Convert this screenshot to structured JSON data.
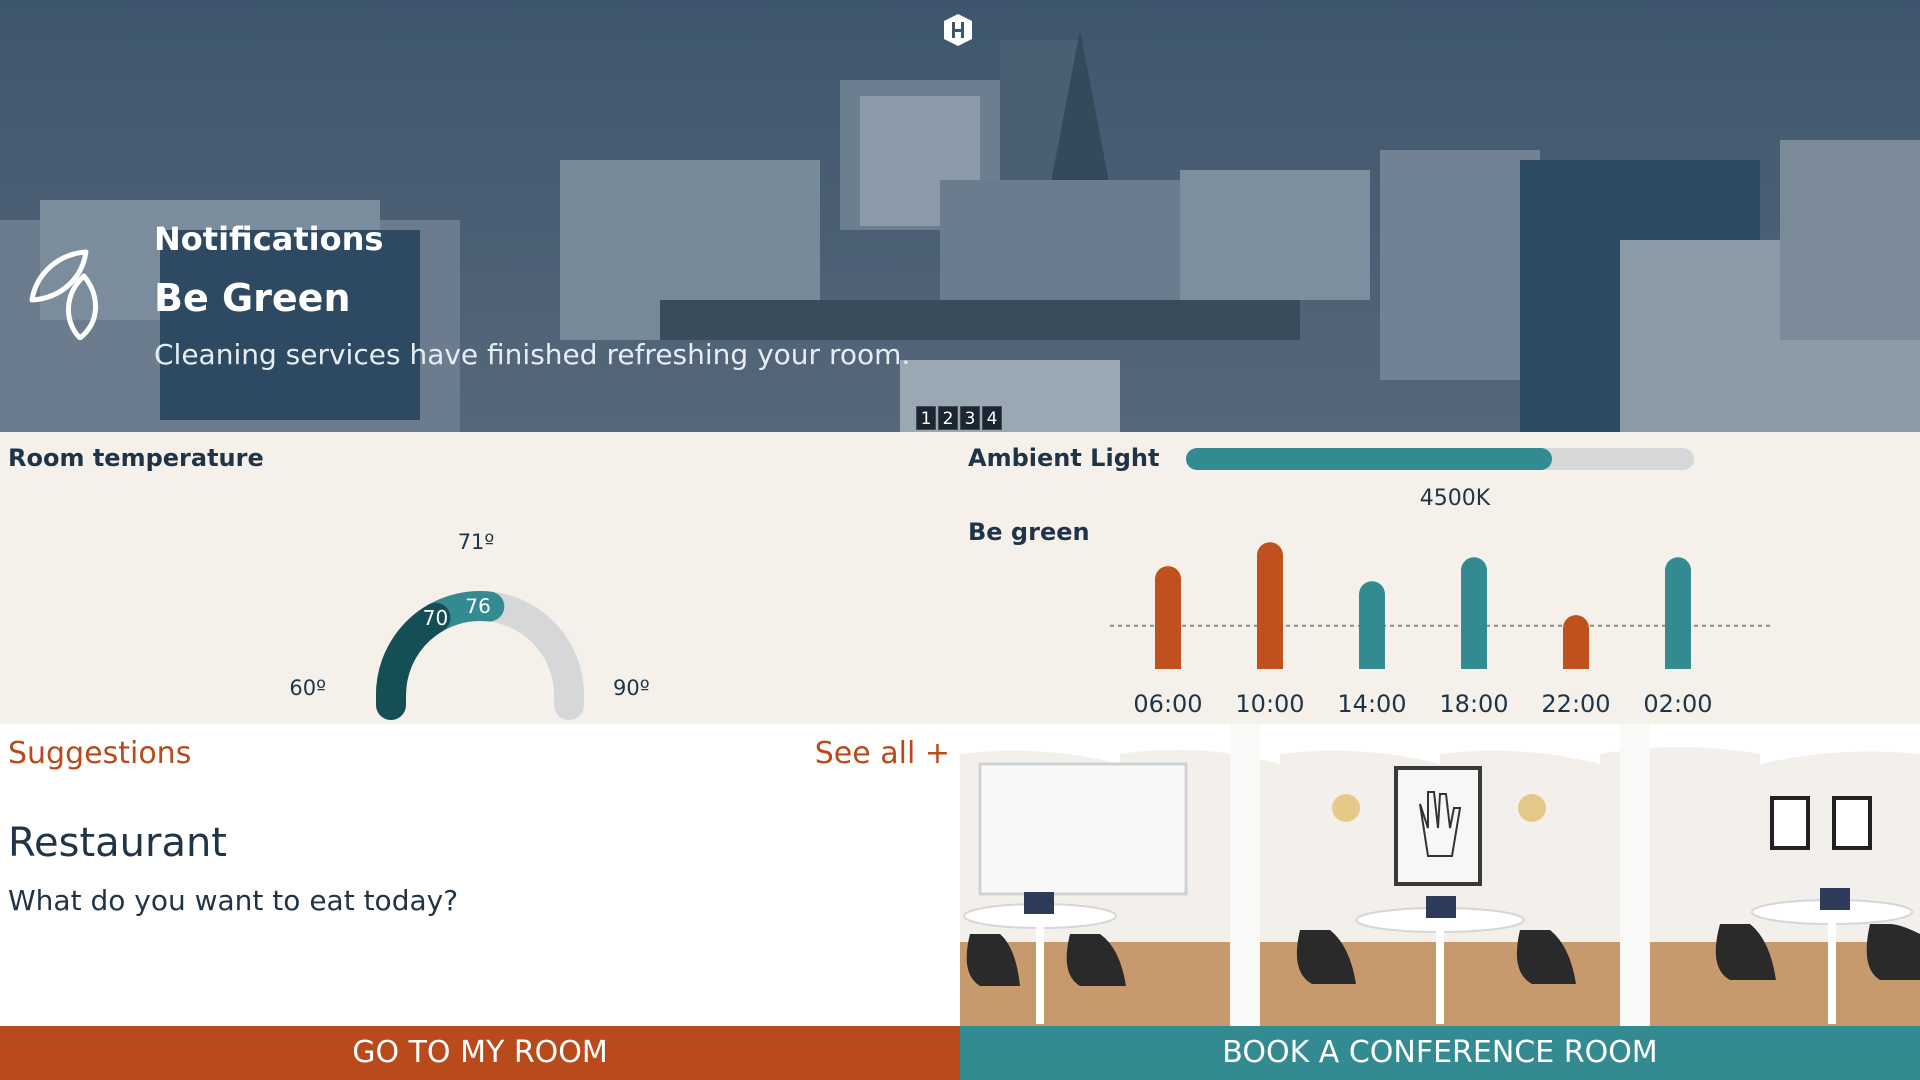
{
  "hero": {
    "kicker": "Notifications",
    "title": "Be Green",
    "message": "Cleaning services have finished refreshing your room.",
    "pages": [
      "1",
      "2",
      "3",
      "4"
    ],
    "icon": "leaf-icon",
    "logo": "hotel-logo-icon"
  },
  "temperature": {
    "title": "Room temperature",
    "min_label": "60º",
    "max_label": "90º",
    "target_label": "71º",
    "current_label": "70",
    "setpoint_label": "76",
    "min": 60,
    "max": 90,
    "current": 70,
    "setpoint": 76,
    "colors": {
      "current": "#154f55",
      "setpoint": "#338a91",
      "track": "#d5d7d8"
    }
  },
  "ambient_light": {
    "title": "Ambient Light",
    "level": 0.72,
    "value_label": "4500K",
    "colors": {
      "fill": "#338a91",
      "track": "#d5d7d8"
    }
  },
  "schedule": {
    "title": "Be green",
    "chart_data": {
      "type": "bar",
      "categories": [
        "06:00",
        "10:00",
        "14:00",
        "18:00",
        "22:00",
        "02:00"
      ],
      "values": [
        0.81,
        1.0,
        0.69,
        0.88,
        0.42,
        0.88
      ],
      "colors": [
        "#c0501e",
        "#c0501e",
        "#338a91",
        "#338a91",
        "#c0501e",
        "#338a91"
      ],
      "baseline": 0.42,
      "ylim": [
        0,
        1
      ]
    }
  },
  "suggestions": {
    "title": "Suggestions",
    "see_all": "See all +",
    "item": {
      "name": "Restaurant",
      "description": "What do you want to eat today?"
    }
  },
  "buttons": {
    "room": "GO TO MY ROOM",
    "conference": "BOOK A CONFERENCE ROOM"
  },
  "colors": {
    "accent_orange": "#b94a1c",
    "accent_teal": "#338a91",
    "navy": "#1f3446",
    "panel_bg": "#f5f1ea"
  }
}
